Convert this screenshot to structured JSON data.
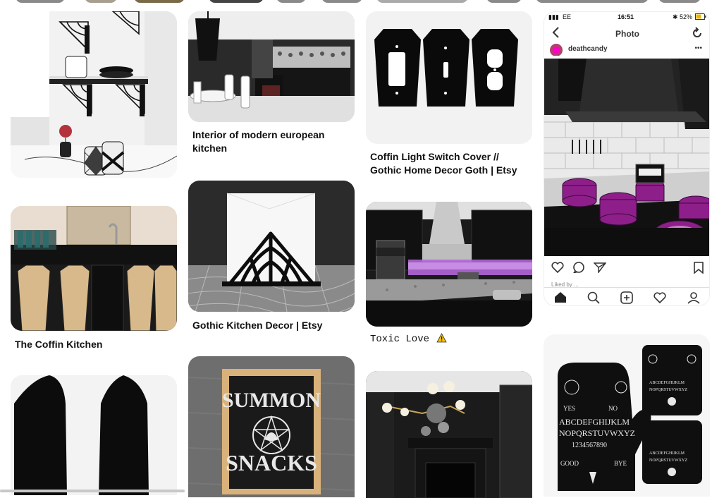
{
  "pins": [
    {
      "title": "Interior of modern european kitchen",
      "image": "Black and white kitchen interior with chandelier"
    },
    {
      "title": "Coffin Light Switch Cover // Gothic Home Decor Goth | Etsy",
      "image": "Coffin shaped light switch covers"
    },
    {
      "title": "The Coffin Kitchen",
      "image": "Kitchen with coffin shaped cabinets"
    },
    {
      "title": "Gothic Kitchen Decor | Etsy",
      "image": "Spiderweb napkin holder"
    },
    {
      "title": "Toxic Love",
      "image": "Dark kitchen with purple lighting"
    }
  ],
  "phone": {
    "carrier": "EE",
    "time": "16:51",
    "battery": "52%",
    "screen_title": "Photo",
    "username": "deathcandy",
    "liked_text": "Liked by ..."
  },
  "art": {
    "sign_line1": "SUMMON",
    "sign_line2": "SNACKS",
    "mitt_yes": "YES",
    "mitt_no": "NO",
    "mitt_alphabet1": "ABCDEFGHIJKLM",
    "mitt_alphabet2": "NOPQRSTUVWXYZ",
    "mitt_numbers": "1234567890",
    "mitt_good": "GOOD",
    "mitt_bye": "BYE"
  },
  "colors": {
    "accent_purple": "#9b2fae",
    "text": "#111111",
    "image_bg_light": "#eeeeee"
  }
}
